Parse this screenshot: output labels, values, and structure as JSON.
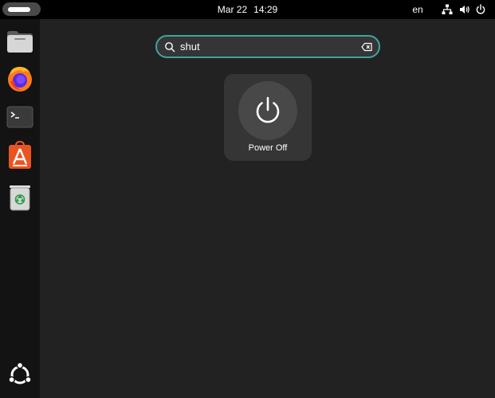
{
  "topbar": {
    "date": "Mar 22",
    "time": "14:29",
    "language": "en",
    "tray_icons": [
      "network-icon",
      "volume-icon",
      "power-icon"
    ]
  },
  "dock": {
    "items": [
      {
        "name": "files",
        "icon": "folder-icon"
      },
      {
        "name": "firefox",
        "icon": "firefox-icon"
      },
      {
        "name": "terminal",
        "icon": "terminal-icon"
      },
      {
        "name": "app-center",
        "icon": "app-center-icon"
      },
      {
        "name": "trash",
        "icon": "trash-icon"
      }
    ],
    "show_apps_icon": "ubuntu-icon"
  },
  "search": {
    "value": "shut",
    "clear_icon": "backspace-clear-icon",
    "accent_color": "#3fa4a0"
  },
  "results": [
    {
      "label": "Power Off",
      "icon": "power-icon"
    }
  ],
  "colors": {
    "background": "#222222",
    "topbar": "#000000",
    "dock": "#131313",
    "tile": "#353535"
  }
}
